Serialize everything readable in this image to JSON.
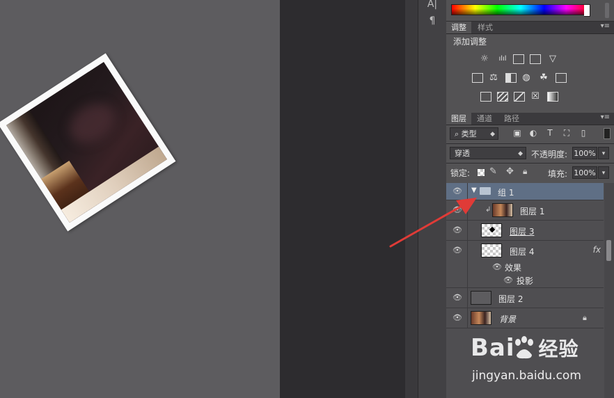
{
  "iconbar": {
    "glyph_top": "A|",
    "glyph_paragraph": "¶"
  },
  "colors": {
    "canvas": "#5d5c5f",
    "panel": "#535254",
    "selection": "#5f6f85",
    "arrow": "#e03b37"
  },
  "adjust_panel": {
    "tabs": [
      "调整",
      "样式"
    ],
    "title": "添加调整"
  },
  "layers_panel": {
    "tabs": [
      "图层",
      "通道",
      "路径"
    ],
    "filter_kind": "类型",
    "blend_mode": "穿透",
    "opacity_label": "不透明度:",
    "opacity_value": "100%",
    "lock_label": "锁定:",
    "fill_label": "填充:",
    "fill_value": "100%",
    "layers": [
      {
        "name": "组 1"
      },
      {
        "name": "图层 1"
      },
      {
        "name": "图层 3"
      },
      {
        "name": "图层 4",
        "fx": "fx"
      },
      {
        "name": "效果"
      },
      {
        "name": "投影"
      },
      {
        "name": "图层 2"
      },
      {
        "name": "背景"
      }
    ]
  },
  "watermark": {
    "logo_left": "Bai",
    "logo_right": "经验",
    "url": "jingyan.baidu.com"
  }
}
